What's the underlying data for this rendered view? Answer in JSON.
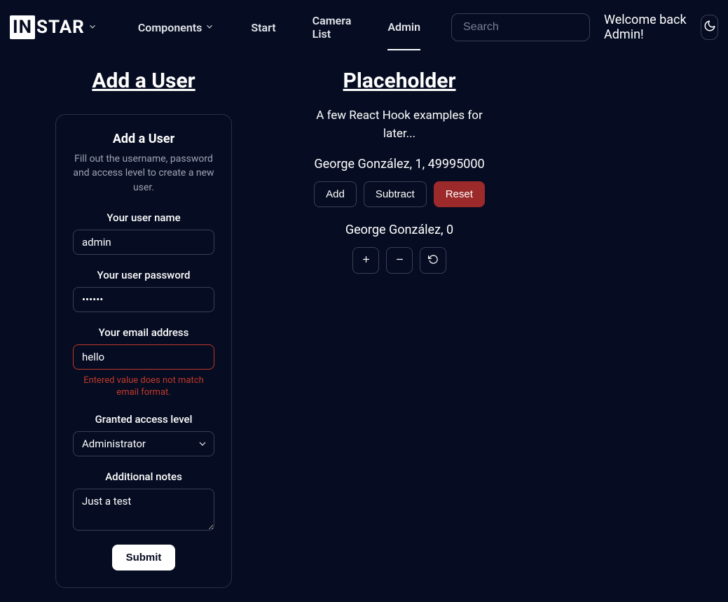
{
  "brand": {
    "in": "IN",
    "star": "STAR"
  },
  "nav": {
    "components": "Components",
    "start": "Start",
    "camera_list": "Camera List",
    "admin": "Admin"
  },
  "search": {
    "placeholder": "Search"
  },
  "welcome": "Welcome back Admin!",
  "left": {
    "section_title": "Add a User",
    "card_title": "Add a User",
    "card_subtext": "Fill out the username, password and access level to create a new user.",
    "username_label": "Your user name",
    "username_value": "admin",
    "password_label": "Your user password",
    "password_value": "••••••",
    "email_label": "Your email address",
    "email_value": "hello",
    "email_error": "Entered value does not match email format.",
    "access_label": "Granted access level",
    "access_value": "Administrator",
    "notes_label": "Additional notes",
    "notes_value": "Just a test",
    "submit": "Submit"
  },
  "right": {
    "section_title": "Placeholder",
    "subtitle": "A few React Hook examples for later...",
    "line1": "George González, 1, 49995000",
    "add": "Add",
    "subtract": "Subtract",
    "reset": "Reset",
    "line2": "George González, 0"
  }
}
